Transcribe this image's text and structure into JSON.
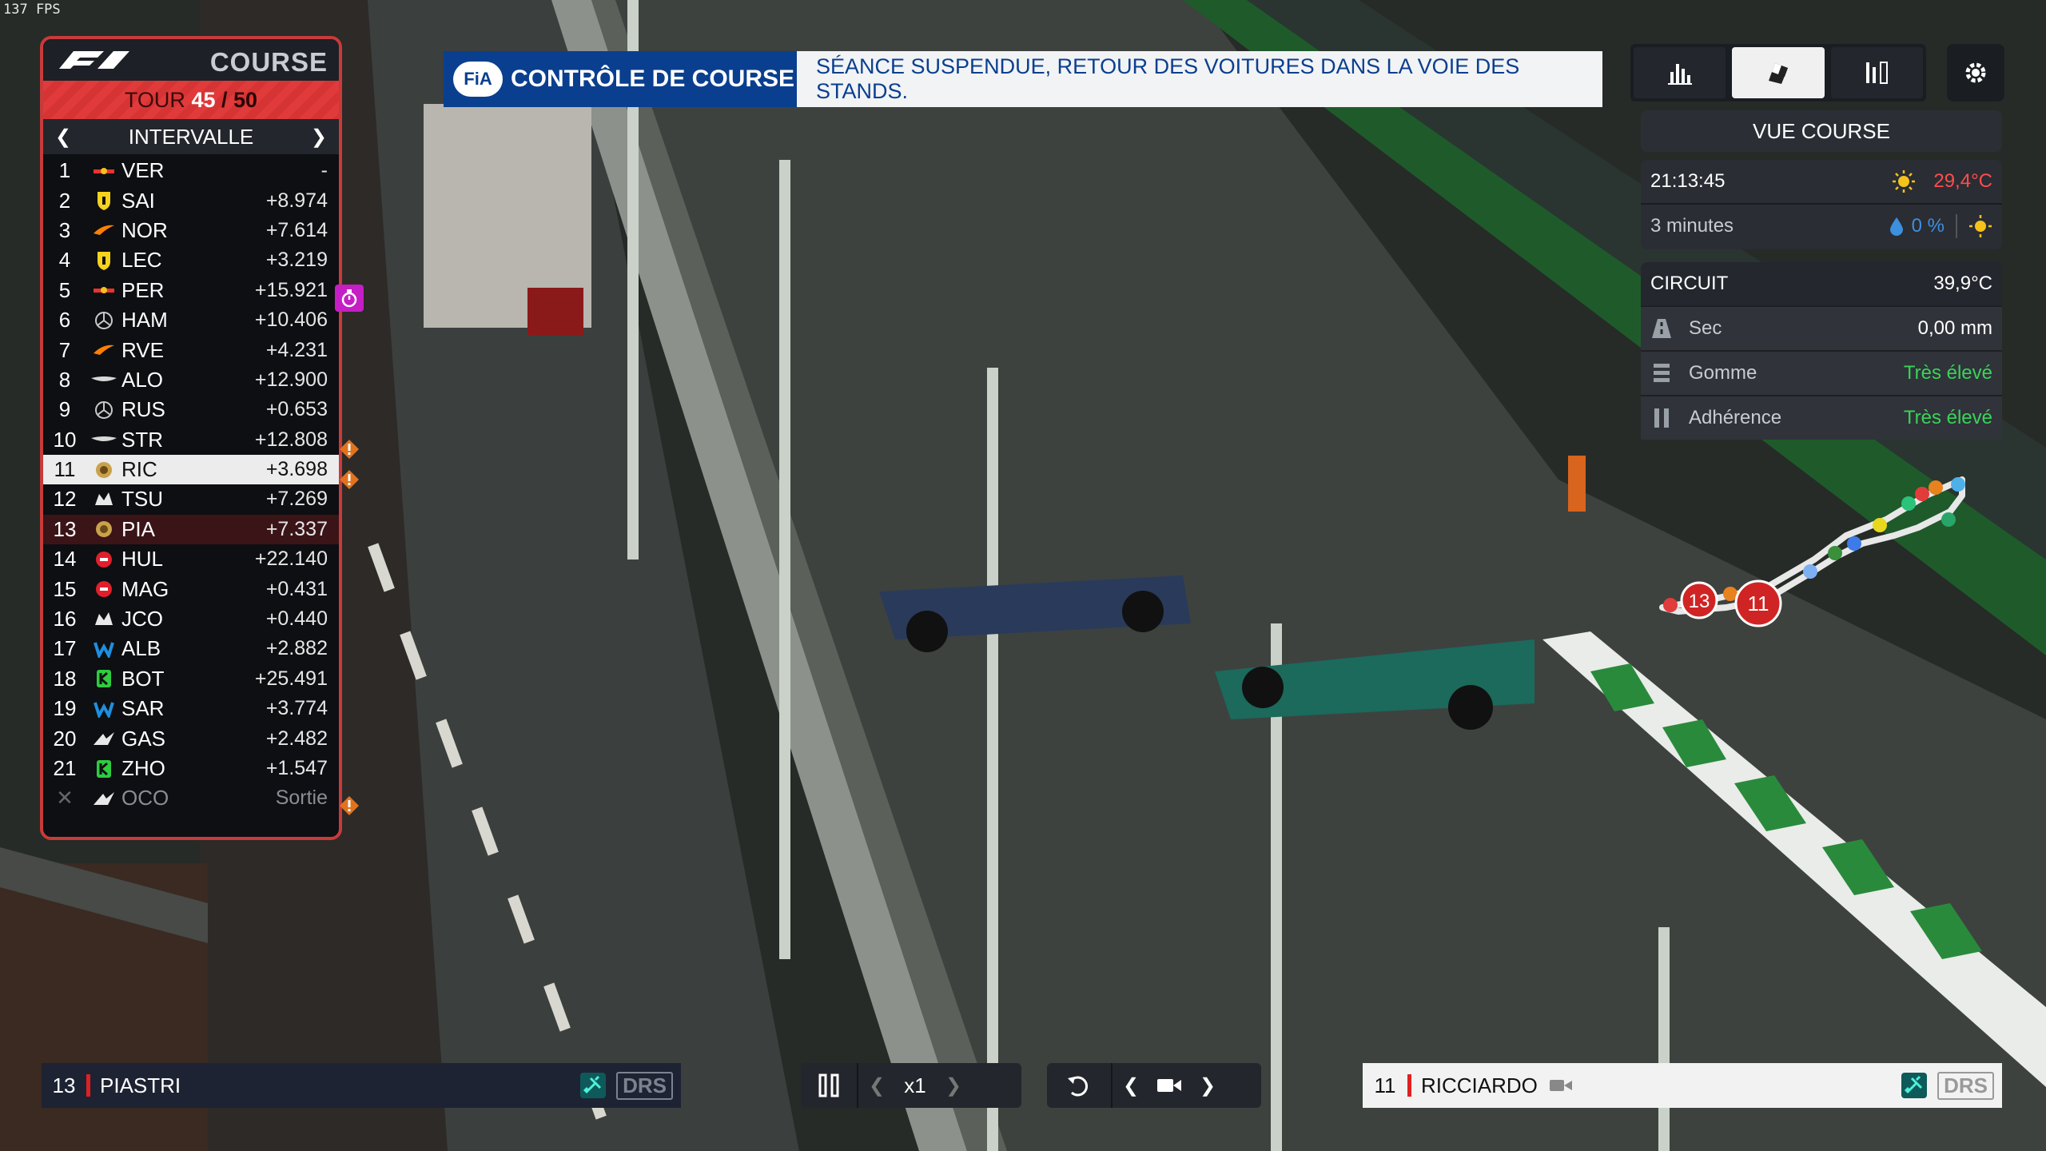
{
  "fps": "137 FPS",
  "leaderboard": {
    "title": "COURSE",
    "lap_prefix": "TOUR",
    "lap_current": "45",
    "lap_total": "50",
    "mode": "INTERVALLE",
    "rows": [
      {
        "pos": "1",
        "code": "VER",
        "gap": "-",
        "team": "redbull"
      },
      {
        "pos": "2",
        "code": "SAI",
        "gap": "+8.974",
        "team": "ferrari"
      },
      {
        "pos": "3",
        "code": "NOR",
        "gap": "+7.614",
        "team": "mclaren"
      },
      {
        "pos": "4",
        "code": "LEC",
        "gap": "+3.219",
        "team": "ferrari"
      },
      {
        "pos": "5",
        "code": "PER",
        "gap": "+15.921",
        "team": "redbull"
      },
      {
        "pos": "6",
        "code": "HAM",
        "gap": "+10.406",
        "team": "mercedes"
      },
      {
        "pos": "7",
        "code": "RVE",
        "gap": "+4.231",
        "team": "mclaren"
      },
      {
        "pos": "8",
        "code": "ALO",
        "gap": "+12.900",
        "team": "aston"
      },
      {
        "pos": "9",
        "code": "RUS",
        "gap": "+0.653",
        "team": "mercedes"
      },
      {
        "pos": "10",
        "code": "STR",
        "gap": "+12.808",
        "team": "aston"
      },
      {
        "pos": "11",
        "code": "RIC",
        "gap": "+3.698",
        "team": "sauber"
      },
      {
        "pos": "12",
        "code": "TSU",
        "gap": "+7.269",
        "team": "alphatauri"
      },
      {
        "pos": "13",
        "code": "PIA",
        "gap": "+7.337",
        "team": "sauber"
      },
      {
        "pos": "14",
        "code": "HUL",
        "gap": "+22.140",
        "team": "haas"
      },
      {
        "pos": "15",
        "code": "MAG",
        "gap": "+0.431",
        "team": "haas"
      },
      {
        "pos": "16",
        "code": "JCO",
        "gap": "+0.440",
        "team": "alphatauri"
      },
      {
        "pos": "17",
        "code": "ALB",
        "gap": "+2.882",
        "team": "williams"
      },
      {
        "pos": "18",
        "code": "BOT",
        "gap": "+25.491",
        "team": "kick"
      },
      {
        "pos": "19",
        "code": "SAR",
        "gap": "+3.774",
        "team": "williams"
      },
      {
        "pos": "20",
        "code": "GAS",
        "gap": "+2.482",
        "team": "alpine"
      },
      {
        "pos": "21",
        "code": "ZHO",
        "gap": "+1.547",
        "team": "kick"
      },
      {
        "pos": "",
        "code": "OCO",
        "gap": "Sortie",
        "team": "alpine"
      }
    ]
  },
  "race_control": {
    "badge": "FiA",
    "title": "CONTRÔLE DE COURSE",
    "message": "SÉANCE SUSPENDUE, RETOUR DES VOITURES DANS LA VOIE DES STANDS."
  },
  "panel": {
    "view_label": "VUE COURSE",
    "time": "21:13:45",
    "air_temp": "29,4°C",
    "forecast_time": "3 minutes",
    "rain_chance": "0 %",
    "circuit_label": "CIRCUIT",
    "track_temp": "39,9°C",
    "surface_label": "Sec",
    "surface_value": "0,00 mm",
    "rubber_label": "Gomme",
    "rubber_value": "Très élevé",
    "grip_label": "Adhérence",
    "grip_value": "Très élevé"
  },
  "minimap": {
    "markers": [
      "13",
      "11"
    ]
  },
  "bottom": {
    "left_number": "13",
    "left_name": "PIASTRI",
    "right_number": "11",
    "right_name": "RICCIARDO",
    "drs_label": "DRS",
    "speed_label": "x1"
  },
  "colors": {
    "accent_red": "#c93a3a",
    "fia_blue": "#0a3f8f",
    "positive_green": "#39d35a",
    "temp_red": "#ff4d4d"
  }
}
